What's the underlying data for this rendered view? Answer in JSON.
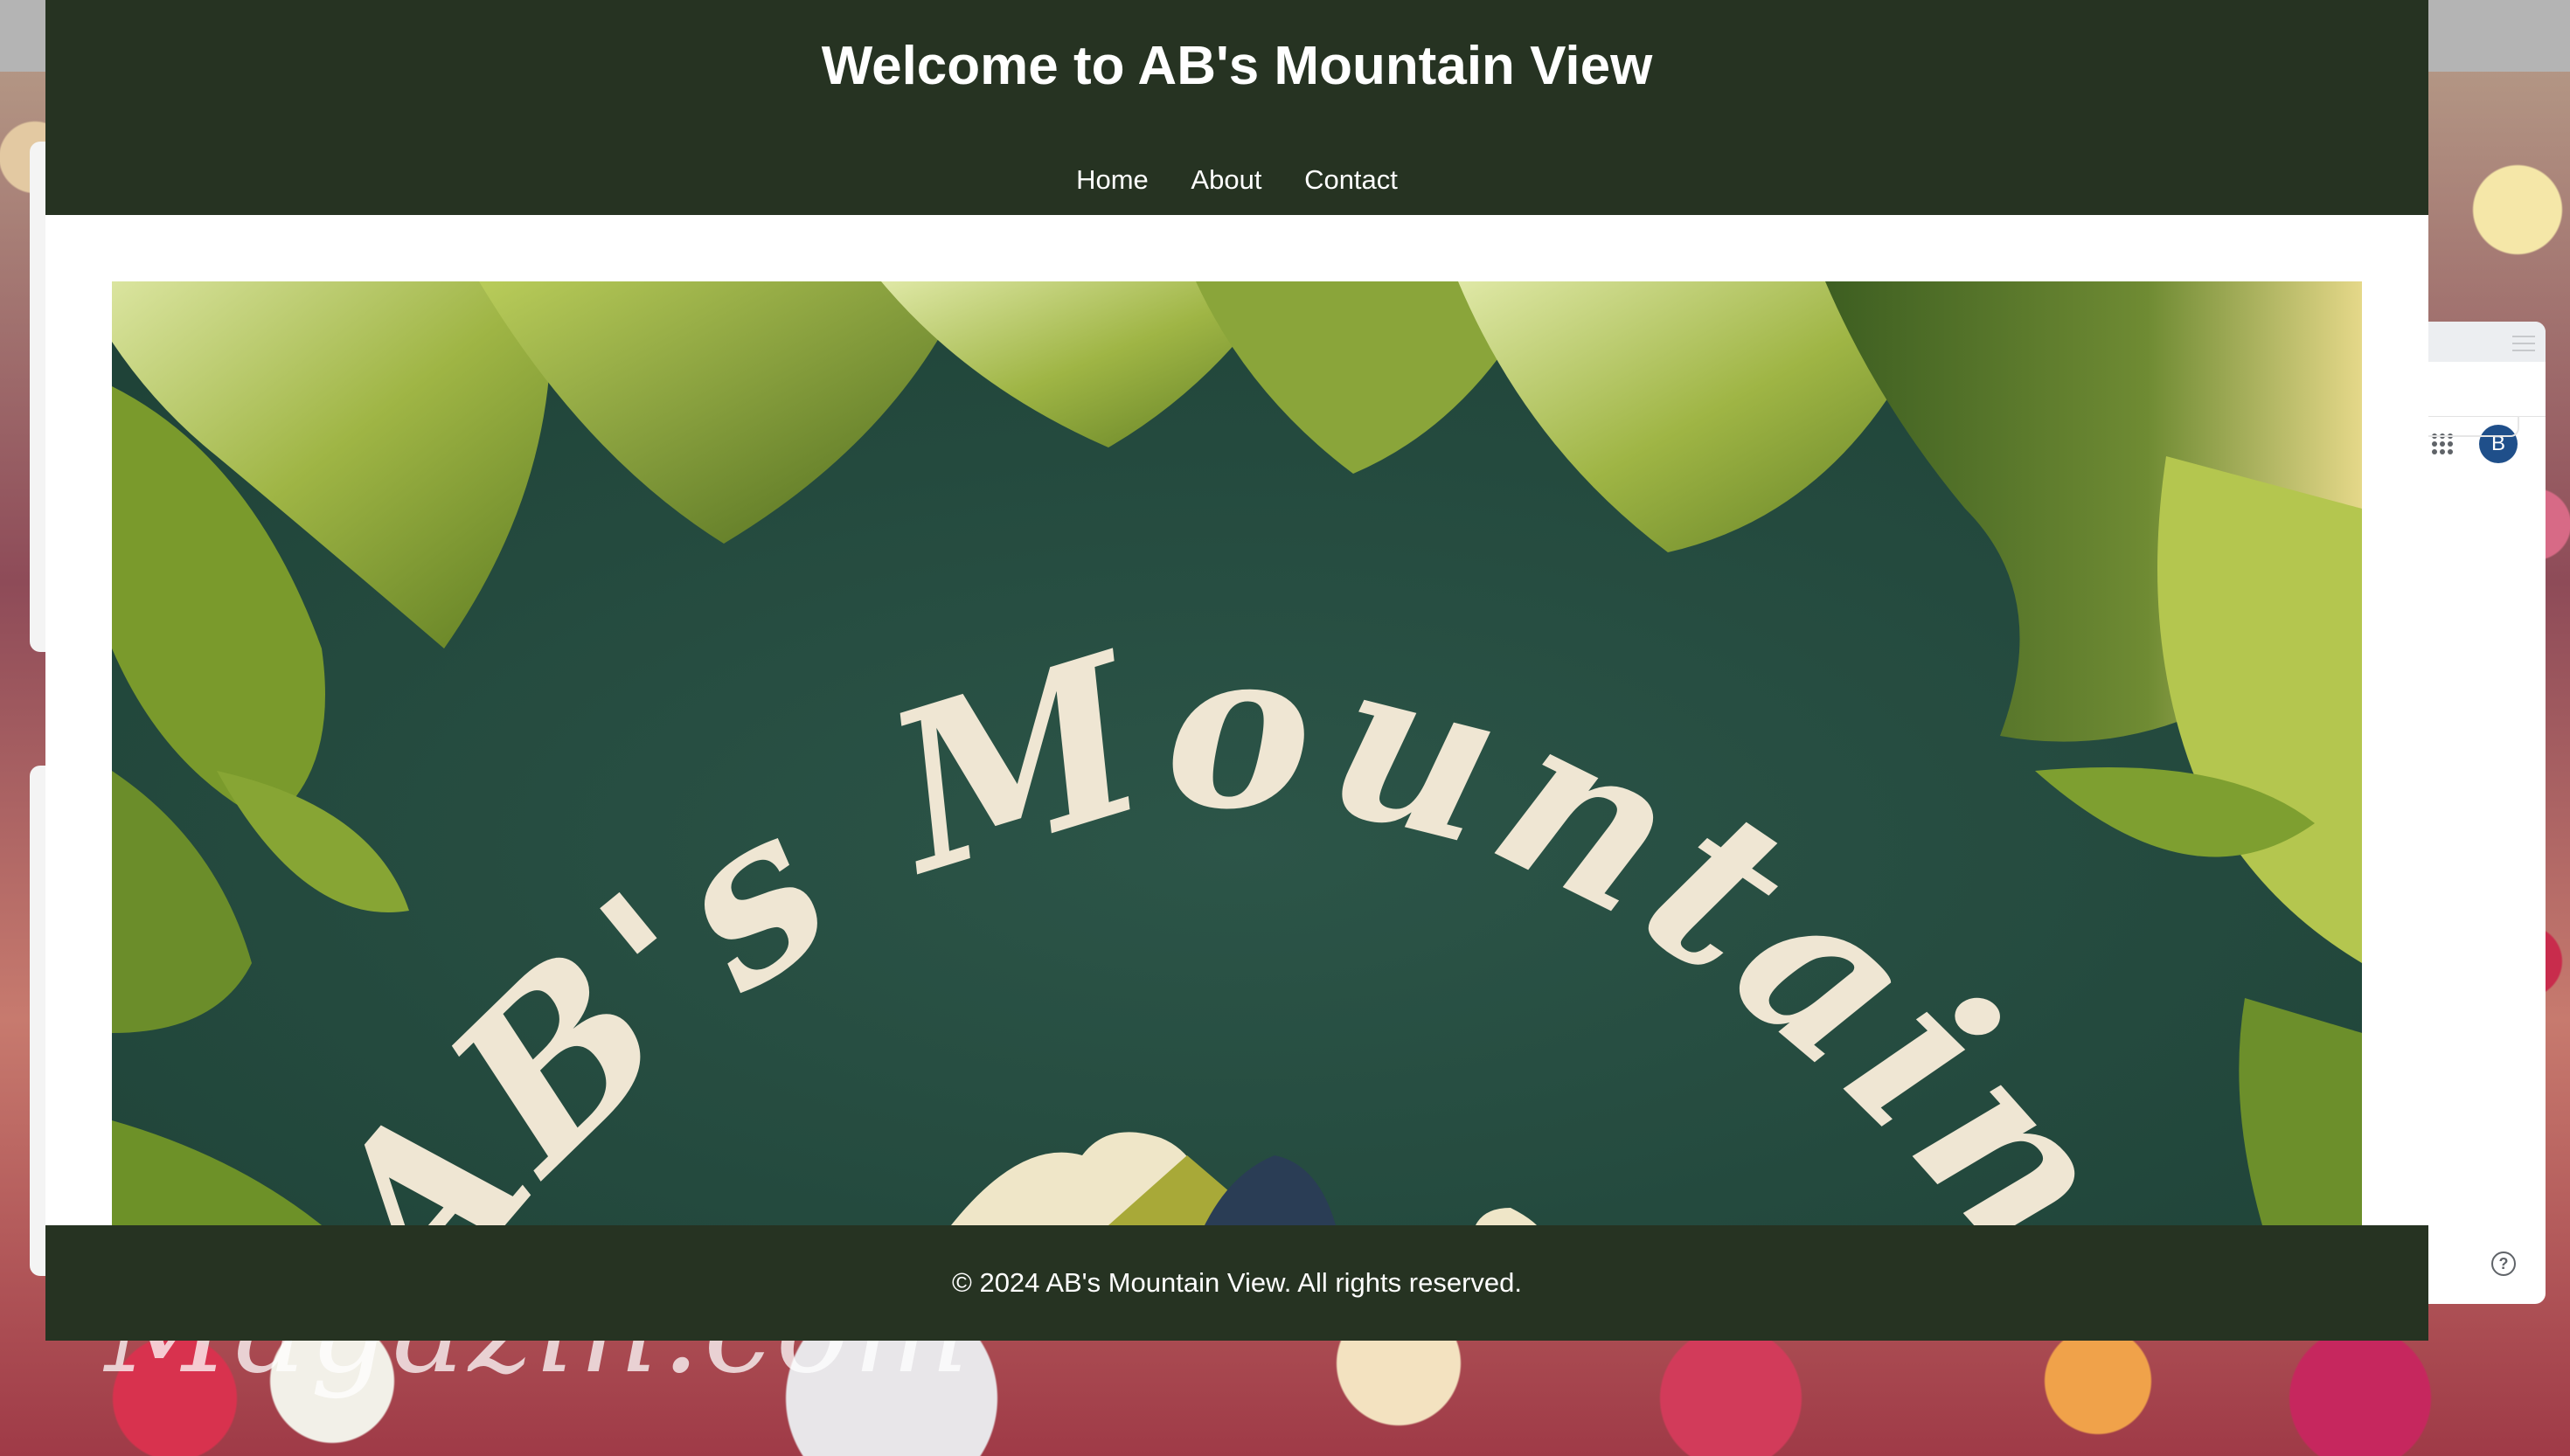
{
  "site": {
    "title": "Welcome to AB's Mountain View",
    "nav": [
      {
        "label": "Home"
      },
      {
        "label": "About"
      },
      {
        "label": "Contact"
      }
    ],
    "hero": {
      "logo_text": "AB's Mountain View",
      "alt": "AB's Mountain View logo on green leaves"
    },
    "footer": "© 2024 AB's Mountain View. All rights reserved."
  },
  "background_window": {
    "avatar_letter": "B",
    "icons": [
      "apps-grid-icon",
      "help-circle-icon",
      "menu-lines-icon"
    ]
  },
  "colors": {
    "header_bg": "#263322",
    "hero_bg": "#244a40",
    "logo_text": "#efe6d3",
    "avatar": "#1f4f8a"
  }
}
